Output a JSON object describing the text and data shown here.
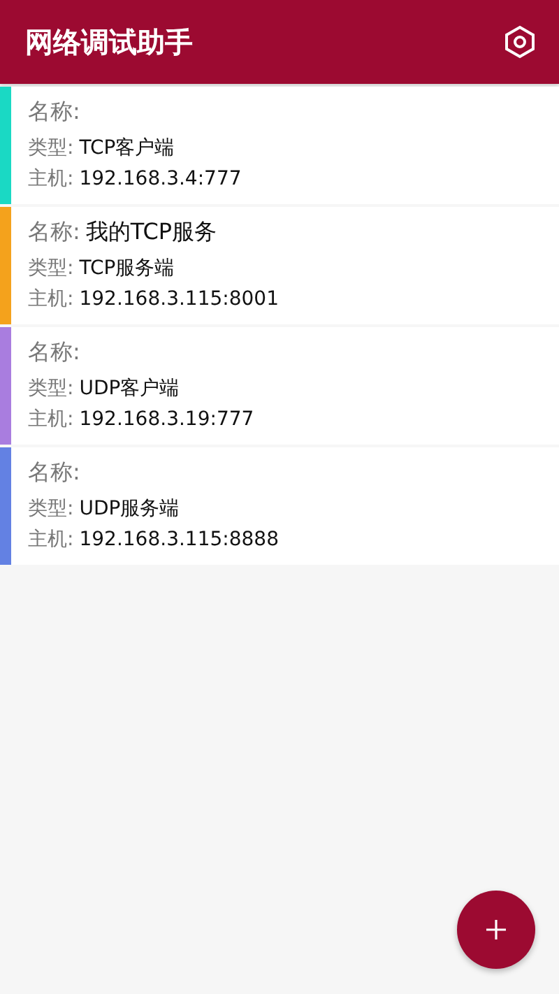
{
  "app_bar": {
    "title": "网络调试助手"
  },
  "connections": [
    {
      "color": "#1ad9c4",
      "name_label": "名称:",
      "type_label": "类型:",
      "type": "TCP客户端",
      "host_label": "主机:",
      "host": "192.168.3.4:777"
    },
    {
      "color": "#f4a21c",
      "name_label": "名称:",
      "name": "我的TCP服务",
      "type_label": "类型:",
      "type": "TCP服务端",
      "host_label": "主机:",
      "host": "192.168.3.115:8001"
    },
    {
      "color": "#a97ddf",
      "name_label": "名称:",
      "type_label": "类型:",
      "type": "UDP客户端",
      "host_label": "主机:",
      "host": "192.168.3.19:777"
    },
    {
      "color": "#6381e3",
      "name_label": "名称:",
      "type_label": "类型:",
      "type": "UDP服务端",
      "host_label": "主机:",
      "host": "192.168.3.115:8888"
    }
  ]
}
